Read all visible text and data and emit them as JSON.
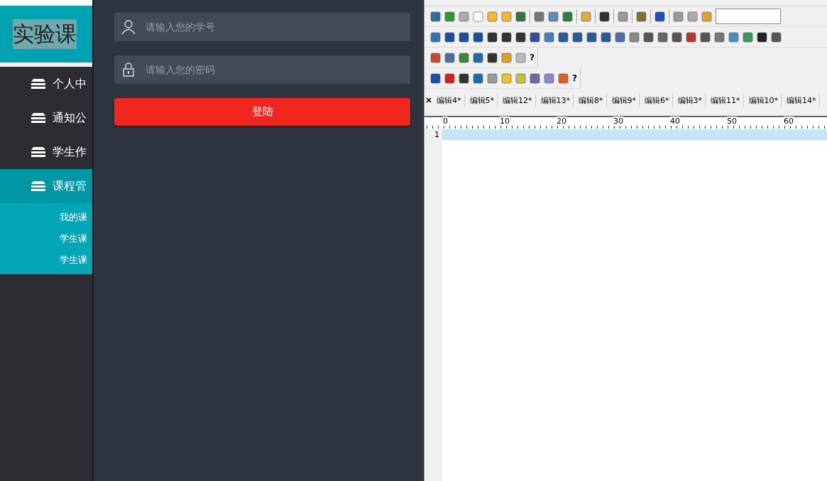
{
  "sidebar": {
    "title": "实验课",
    "items": [
      {
        "label": "个人中",
        "selected": false,
        "expanded": false
      },
      {
        "label": "通知公",
        "selected": false,
        "expanded": false
      },
      {
        "label": "学生作",
        "selected": false,
        "expanded": false
      },
      {
        "label": "课程管",
        "selected": true,
        "expanded": true,
        "children": [
          {
            "label": "我的课"
          },
          {
            "label": "学生课"
          },
          {
            "label": "学生课"
          }
        ]
      }
    ]
  },
  "login": {
    "fields": [
      {
        "kind": "user",
        "placeholder": "请输入您的学号"
      },
      {
        "kind": "lock",
        "placeholder": "请输入您的密码"
      }
    ],
    "button": "登陆"
  },
  "editor": {
    "help_marks": [
      "?",
      "?"
    ],
    "tabs": [
      "编辑4*",
      "编辑5*",
      "编辑12*",
      "编辑13*",
      "编辑8*",
      "编辑9*",
      "编辑6*",
      "编辑3*",
      "编辑11*",
      "编辑10*",
      "编辑14*"
    ],
    "ruler": [
      "0",
      "10",
      "20",
      "30",
      "40",
      "50",
      "60"
    ],
    "line_numbers": [
      "1"
    ]
  }
}
